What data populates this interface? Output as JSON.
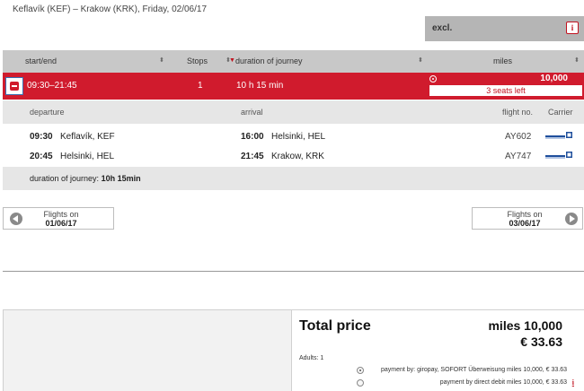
{
  "route": {
    "title": "Keflavík (KEF) – Krakow (KRK),  Friday, 02/06/17"
  },
  "fare": {
    "class_label": "excl.",
    "info_glyph": "i"
  },
  "table": {
    "headers": {
      "start_end": "start/end",
      "stops": "Stops",
      "duration": "duration of journey",
      "miles": "miles"
    }
  },
  "selected_flight": {
    "time": "09:30–21:45",
    "stops": "1",
    "duration": "10 h 15 min",
    "miles": "10,000",
    "seats_left": "3 seats left"
  },
  "details": {
    "headers": {
      "departure": "departure",
      "arrival": "arrival",
      "flight_no": "flight no.",
      "carrier": "Carrier"
    },
    "segments": [
      {
        "dep_time": "09:30",
        "dep_place": "Keflavík, KEF",
        "arr_time": "16:00",
        "arr_place": "Helsinki, HEL",
        "flight": "AY602",
        "carrier_icon": "finnair-logo"
      },
      {
        "dep_time": "20:45",
        "dep_place": "Helsinki, HEL",
        "arr_time": "21:45",
        "arr_place": "Krakow, KRK",
        "flight": "AY747",
        "carrier_icon": "finnair-logo"
      }
    ],
    "duration_label": "duration of journey:",
    "duration_value": "10h 15min"
  },
  "nav": {
    "prev": {
      "label": "Flights on",
      "date": "01/06/17"
    },
    "next": {
      "label": "Flights on",
      "date": "03/06/17"
    }
  },
  "summary": {
    "total_label": "Total price",
    "miles": "miles 10,000",
    "euro": "€ 33.63",
    "adults": "Adults: 1",
    "payments": [
      {
        "text": "payment by: giropay, SOFORT Überweisung miles 10,000, € 33.63",
        "selected": true
      },
      {
        "text": "payment by direct debit miles 10,000, € 33.63",
        "selected": false,
        "info": "i"
      }
    ]
  },
  "colors": {
    "accent": "#d01b2d",
    "header_bg": "#c8c8c8",
    "detail_bg": "#e6e6e6",
    "carrier_blue": "#1f4f9c"
  }
}
